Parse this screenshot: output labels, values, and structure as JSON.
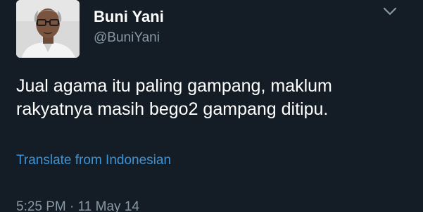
{
  "user": {
    "display_name": "Buni Yani",
    "handle": "@BuniYani"
  },
  "tweet": {
    "line1": "Jual agama itu paling gampang, maklum",
    "line2": "rakyatnya masih bego2 gampang ditipu.",
    "translate_label": "Translate from Indonesian",
    "timestamp": "5:25 PM · 11 May 14"
  },
  "icons": {
    "menu": "chevron-down-icon",
    "avatar": "profile-photo"
  },
  "colors": {
    "background": "#141d26",
    "text": "#ffffff",
    "muted": "#8899a6",
    "link": "#3b94d9"
  }
}
